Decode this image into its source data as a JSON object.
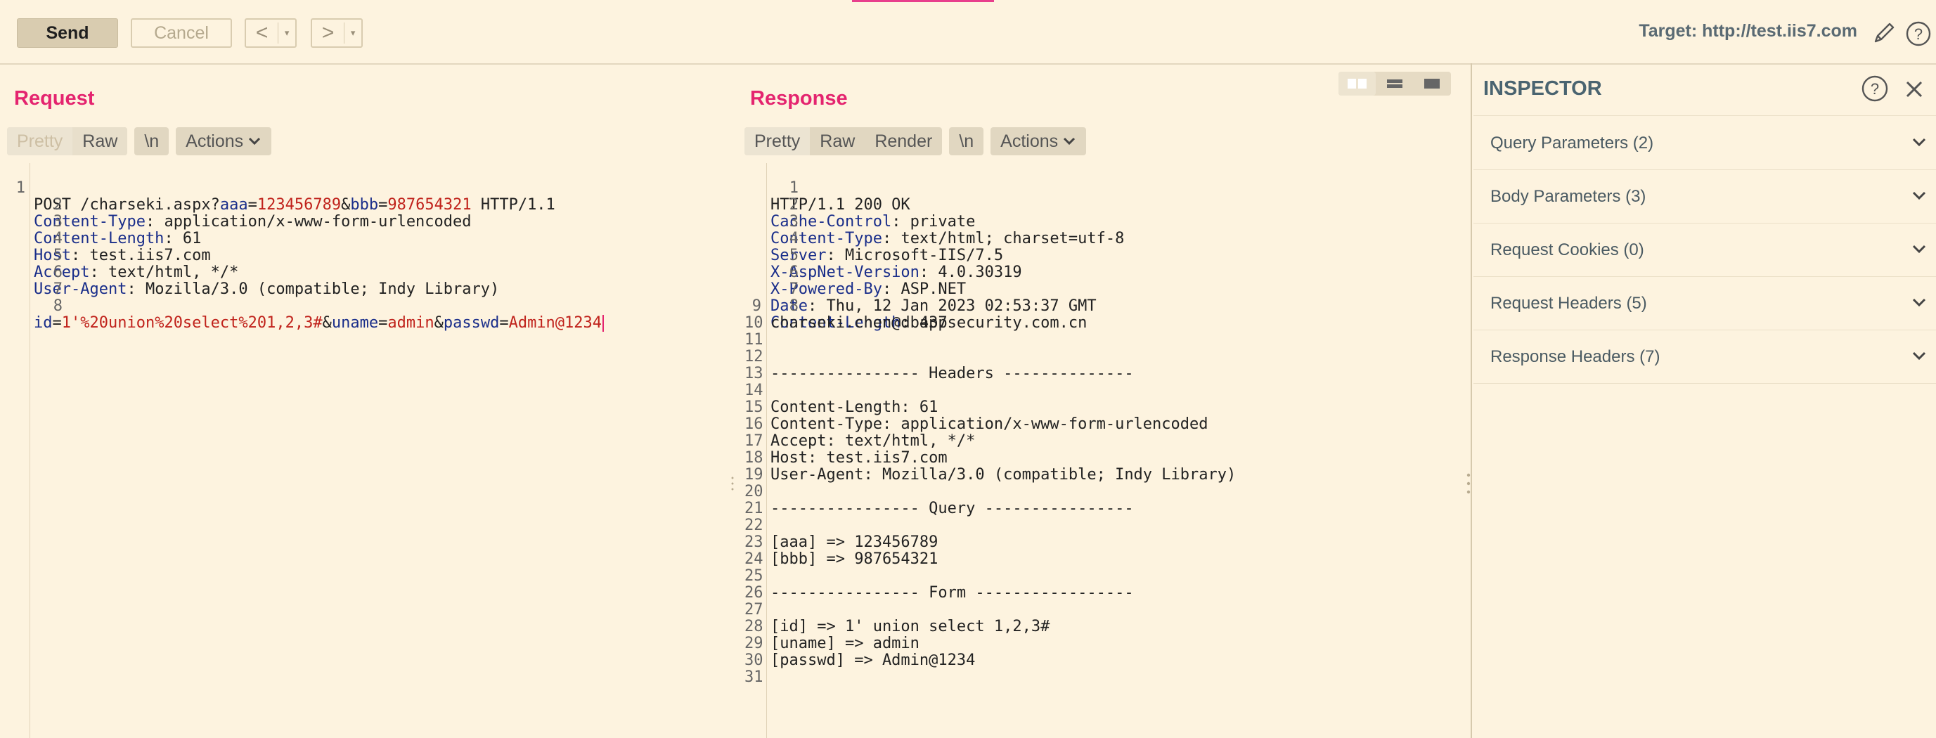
{
  "toolbar": {
    "send_label": "Send",
    "cancel_label": "Cancel",
    "back_glyph": "<",
    "forward_glyph": ">",
    "dropdown_glyph": "▾",
    "target_label": "Target: http://test.iis7.com"
  },
  "request": {
    "title": "Request",
    "tabs": [
      {
        "label": "Pretty"
      },
      {
        "label": "Raw"
      }
    ],
    "newline_label": "\\n",
    "actions_label": "Actions",
    "lines": [
      {
        "n": "1"
      },
      {
        "n": "2"
      },
      {
        "n": "3"
      },
      {
        "n": "4"
      },
      {
        "n": "5"
      },
      {
        "n": "6"
      },
      {
        "n": "7"
      },
      {
        "n": "8"
      }
    ],
    "line1": {
      "method_path": "POST /charseki.aspx?",
      "k1": "aaa",
      "eq": "=",
      "v1": "123456789",
      "amp": "&",
      "k2": "bbb",
      "v2": "987654321",
      "proto": " HTTP/1.1"
    },
    "headers": [
      {
        "name": "Content-Type",
        "value": ": application/x-www-form-urlencoded"
      },
      {
        "name": "Content-Length",
        "value": ": 61"
      },
      {
        "name": "Host",
        "value": ": test.iis7.com"
      },
      {
        "name": "Accept",
        "value": ": text/html, */*"
      },
      {
        "name": "User-Agent",
        "value": ": Mozilla/3.0 (compatible; Indy Library)"
      }
    ],
    "body": {
      "k1": "id",
      "v1": "1'%20union%20select%201,2,3#",
      "k2": "uname",
      "v2": "admin",
      "k3": "passwd",
      "v3": "Admin@1234"
    }
  },
  "response": {
    "title": "Response",
    "tabs": [
      {
        "label": "Pretty"
      },
      {
        "label": "Raw"
      },
      {
        "label": "Render"
      }
    ],
    "newline_label": "\\n",
    "actions_label": "Actions",
    "status_line": "HTTP/1.1 200 OK",
    "headers": [
      {
        "name": "Cache-Control",
        "value": ": private"
      },
      {
        "name": "Content-Type",
        "value": ": text/html; charset=utf-8"
      },
      {
        "name": "Server",
        "value": ": Microsoft-IIS/7.5"
      },
      {
        "name": "X-AspNet-Version",
        "value": ": 4.0.30319"
      },
      {
        "name": "X-Powered-By",
        "value": ": ASP.NET"
      },
      {
        "name": "Date",
        "value": ": Thu, 12 Jan 2023 02:53:37 GMT"
      },
      {
        "name": "Content-Length",
        "value": ": 437"
      }
    ],
    "body_lines": [
      "",
      "charseki.chen@dbappsecurity.com.cn",
      "",
      "",
      "---------------- Headers --------------",
      "",
      "Content-Length: 61",
      "Content-Type: application/x-www-form-urlencoded",
      "Accept: text/html, */*",
      "Host: test.iis7.com",
      "User-Agent: Mozilla/3.0 (compatible; Indy Library)",
      "",
      "---------------- Query ----------------",
      "",
      "[aaa] => 123456789",
      "[bbb] => 987654321",
      "",
      "---------------- Form -----------------",
      "",
      "[id] => 1' union select 1,2,3#",
      "[uname] => admin",
      "[passwd] => Admin@1234",
      ""
    ],
    "line_numbers": [
      "1",
      "2",
      "3",
      "4",
      "5",
      "6",
      "7",
      "8",
      "9",
      "10",
      "11",
      "12",
      "13",
      "14",
      "15",
      "16",
      "17",
      "18",
      "19",
      "20",
      "21",
      "22",
      "23",
      "24",
      "25",
      "26",
      "27",
      "28",
      "29",
      "30",
      "31"
    ]
  },
  "inspector": {
    "title": "INSPECTOR",
    "sections": [
      {
        "label": "Query Parameters (2)"
      },
      {
        "label": "Body Parameters (3)"
      },
      {
        "label": "Request Cookies (0)"
      },
      {
        "label": "Request Headers (5)"
      },
      {
        "label": "Response Headers (7)"
      }
    ]
  },
  "colors": {
    "background": "#fdf3df",
    "accent": "#e4246f",
    "header_name": "#1a2e8a",
    "param_value": "#c0221b"
  }
}
